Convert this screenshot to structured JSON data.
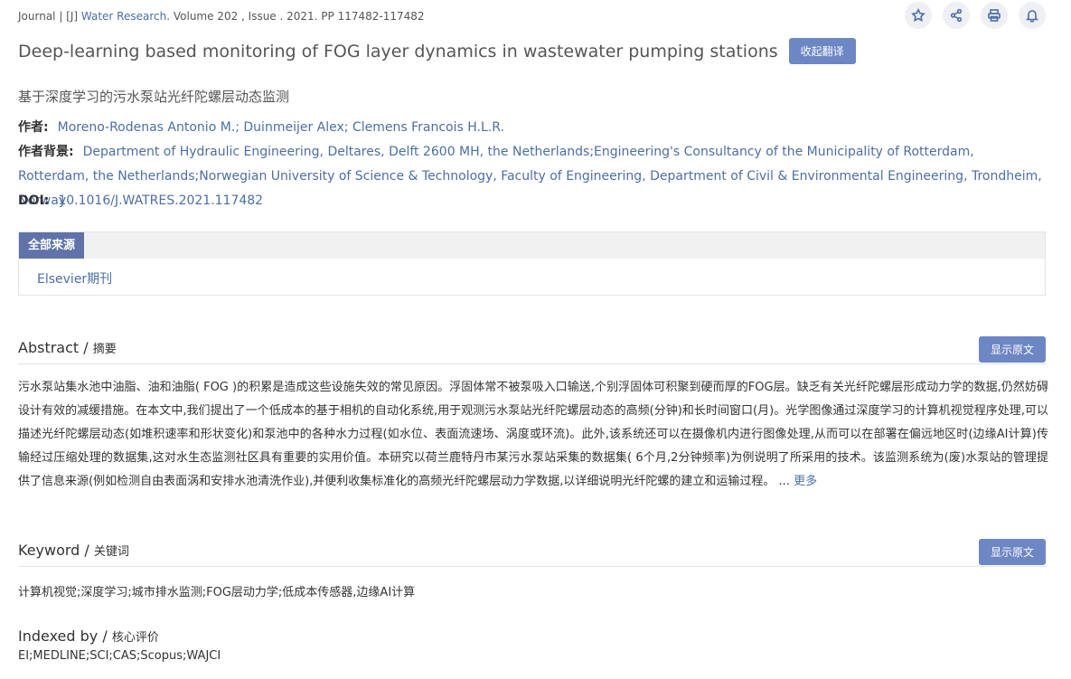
{
  "meta": {
    "prefix": "Journal | [J] ",
    "journal_name": "Water Research",
    "details": ". Volume 202 , Issue . 2021. PP 117482-117482"
  },
  "actions": [
    {
      "icon": "star-icon"
    },
    {
      "icon": "share-icon"
    },
    {
      "icon": "print-icon"
    },
    {
      "icon": "bell-icon"
    }
  ],
  "title": "Deep-learning based monitoring of FOG layer dynamics in wastewater pumping stations",
  "collapse_translation_label": "收起翻译",
  "cn_title": "基于深度学习的污水泵站光纤陀螺层动态监测",
  "authors": {
    "label": "作者:",
    "value": "Moreno-Rodenas Antonio M.; Duinmeijer Alex; Clemens Francois H.L.R."
  },
  "affiliation": {
    "label": "作者背景:",
    "value": "Department of Hydraulic Engineering, Deltares, Delft 2600 MH, the Netherlands;Engineering's Consultancy of the Municipality of Rotterdam, Rotterdam, the Netherlands;Norwegian University of Science & Technology, Faculty of Engineering, Department of Civil & Environmental Engineering, Trondheim, Norway"
  },
  "doi": {
    "label": "DOI:",
    "value": "10.1016/J.WATRES.2021.117482"
  },
  "sources": {
    "tab_label": "全部来源",
    "items": [
      "Elsevier期刊"
    ]
  },
  "abstract": {
    "title": "Abstract / ",
    "title_cn": "摘要",
    "show_original_label": "显示原文",
    "text": "污水泵站集水池中油脂、油和油脂( FOG )的积累是造成这些设施失效的常见原因。浮固体常不被泵吸入口输送,个别浮固体可积聚到硬而厚的FOG层。缺乏有关光纤陀螺层形成动力学的数据,仍然妨碍设计有效的减缓措施。在本文中,我们提出了一个低成本的基于相机的自动化系统,用于观测污水泵站光纤陀螺层动态的高频(分钟)和长时间窗口(月)。光学图像通过深度学习的计算机视觉程序处理,可以描述光纤陀螺层动态(如堆积速率和形状变化)和泵池中的各种水力过程(如水位、表面流速场、涡度或环流)。此外,该系统还可以在摄像机内进行图像处理,从而可以在部署在偏远地区时(边缘AI计算)传输经过压缩处理的数据集,这对水生态监测社区具有重要的实用价值。本研究以荷兰鹿特丹市某污水泵站采集的数据集( 6个月,2分钟频率)为例说明了所采用的技术。该监测系统为(废)水泵站的管理提供了信息来源(例如检测自由表面涡和安排水池清洗作业),并便利收集标准化的高频光纤陀螺层动力学数据,以详细说明光纤陀螺的建立和运输过程。",
    "ellipsis": " ... ",
    "more_label": "更多"
  },
  "keyword": {
    "title": "Keyword / ",
    "title_cn": "关键词",
    "show_original_label": "显示原文",
    "text": "计算机视觉;深度学习;城市排水监测;FOG层动力学;低成本传感器,边缘AI计算"
  },
  "indexed": {
    "title": "Indexed by / ",
    "title_cn": "核心评价",
    "value": "EI;MEDLINE;SCI;CAS;Scopus;WAJCI"
  },
  "colors": {
    "accent_button": "#6d86c4",
    "link": "#4a6fa5",
    "source_tab": "#5f72a9"
  }
}
